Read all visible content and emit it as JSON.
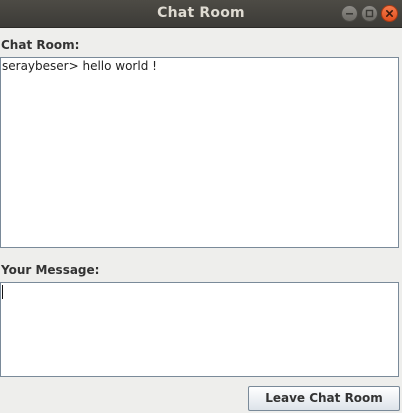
{
  "window": {
    "title": "Chat Room",
    "controls": [
      "minimize-icon",
      "maximize-icon",
      "close-icon"
    ]
  },
  "chat": {
    "label": "Chat Room:",
    "content": "seraybeser> hello world !"
  },
  "message": {
    "label": "Your Message:",
    "value": ""
  },
  "actions": {
    "leave_label": "Leave Chat Room"
  },
  "colors": {
    "titlebar": "#3c3b37",
    "close_button": "#e0501f",
    "background": "#eeeeec"
  }
}
